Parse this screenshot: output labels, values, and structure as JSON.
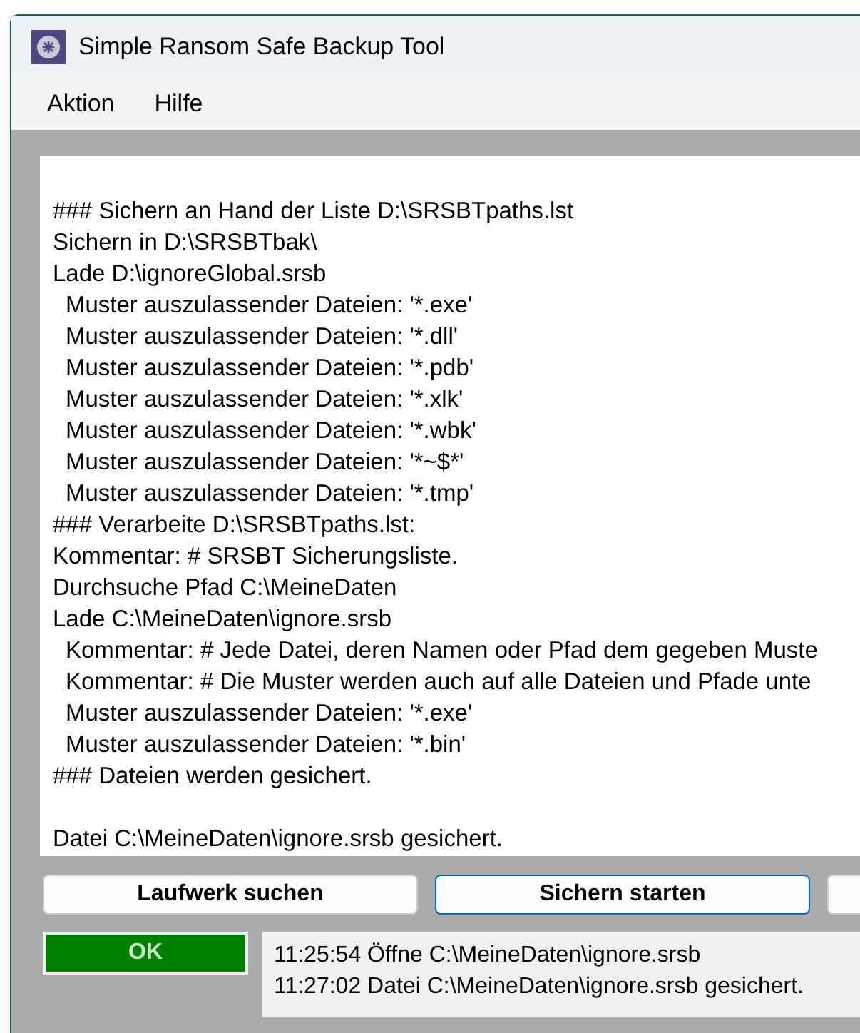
{
  "window": {
    "title": "Simple Ransom Safe Backup Tool"
  },
  "menu": [
    "Aktion",
    "Hilfe"
  ],
  "log": {
    "lines": [
      {
        "text": "### Sichern an Hand der Liste D:\\SRSBTpaths.lst",
        "indent": false
      },
      {
        "text": "Sichern in D:\\SRSBTbak\\",
        "indent": false
      },
      {
        "text": "Lade D:\\ignoreGlobal.srsb",
        "indent": false
      },
      {
        "text": "Muster auszulassender Dateien: '*.exe'",
        "indent": true
      },
      {
        "text": "Muster auszulassender Dateien: '*.dll'",
        "indent": true
      },
      {
        "text": "Muster auszulassender Dateien: '*.pdb'",
        "indent": true
      },
      {
        "text": "Muster auszulassender Dateien: '*.xlk'",
        "indent": true
      },
      {
        "text": "Muster auszulassender Dateien: '*.wbk'",
        "indent": true
      },
      {
        "text": "Muster auszulassender Dateien: '*~$*'",
        "indent": true
      },
      {
        "text": "Muster auszulassender Dateien: '*.tmp'",
        "indent": true
      },
      {
        "text": "### Verarbeite D:\\SRSBTpaths.lst:",
        "indent": false
      },
      {
        "text": "Kommentar: # SRSBT Sicherungsliste.",
        "indent": false
      },
      {
        "text": "Durchsuche Pfad C:\\MeineDaten",
        "indent": false
      },
      {
        "text": "Lade C:\\MeineDaten\\ignore.srsb",
        "indent": false
      },
      {
        "text": "Kommentar: # Jede Datei, deren Namen oder Pfad dem gegeben Muste",
        "indent": true
      },
      {
        "text": "Kommentar: # Die Muster werden auch auf alle Dateien und Pfade unte",
        "indent": true
      },
      {
        "text": "Muster auszulassender Dateien: '*.exe'",
        "indent": true
      },
      {
        "text": "Muster auszulassender Dateien: '*.bin'",
        "indent": true
      },
      {
        "text": "### Dateien werden gesichert.",
        "indent": false
      }
    ],
    "saved_lines": [
      "Datei C:\\MeineDaten\\ignore.srsb gesichert."
    ]
  },
  "buttons": [
    {
      "label": "Laufwerk suchen",
      "focused": false
    },
    {
      "label": "Sichern starten",
      "focused": true
    },
    {
      "focused": false
    }
  ],
  "status": {
    "label": "OK",
    "color": "#008000"
  },
  "status_log": [
    "11:25:54 Öffne C:\\MeineDaten\\ignore.srsb",
    "11:27:02 Datei C:\\MeineDaten\\ignore.srsb gesichert."
  ]
}
